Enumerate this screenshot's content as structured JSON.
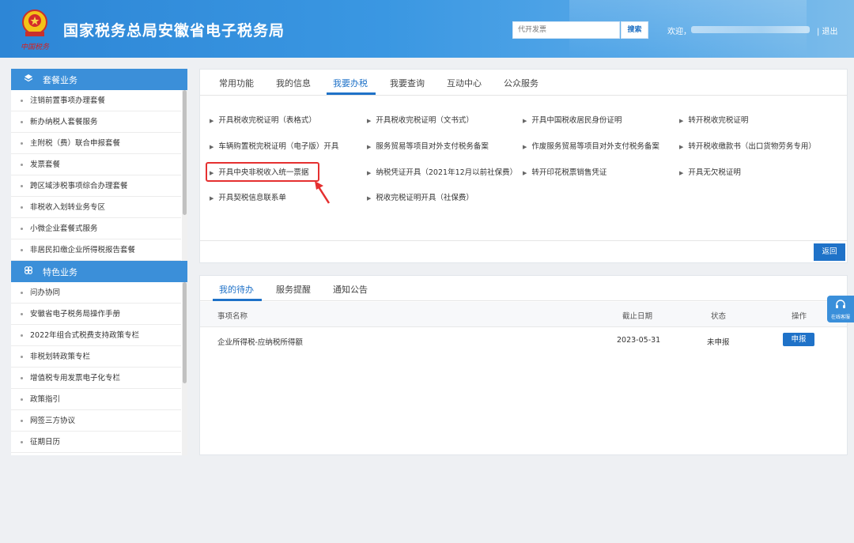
{
  "header": {
    "title": "国家税务总局安徽省电子税务局",
    "emblem_signature": "中国税务",
    "search_placeholder": "代开发票",
    "search_button": "搜索",
    "welcome": "欢迎，",
    "logout": "| 退出",
    "brand_color": "#3a97e2"
  },
  "sidebar": {
    "package_title": "套餐业务",
    "package_items": [
      "注销前置事项办理套餐",
      "新办纳税人套餐服务",
      "主附税（费）联合申报套餐",
      "发票套餐",
      "跨区域涉税事项综合办理套餐",
      "非税收入划转业务专区",
      "小微企业套餐式服务",
      "非居民扣缴企业所得税报告套餐"
    ],
    "feature_title": "特色业务",
    "feature_items": [
      "问办协同",
      "安徽省电子税务局操作手册",
      "2022年组合式税费支持政策专栏",
      "非税划转政策专栏",
      "增值税专用发票电子化专栏",
      "政策指引",
      "网签三方协议",
      "征期日历"
    ]
  },
  "top_tabs": [
    "常用功能",
    "我的信息",
    "我要办税",
    "我要查询",
    "互动中心",
    "公众服务"
  ],
  "services": [
    "开具税收完税证明（表格式）",
    "开具税收完税证明（文书式）",
    "开具中国税收居民身份证明",
    "转开税收完税证明",
    "车辆购置税完税证明（电子版）开具",
    "服务贸易等项目对外支付税务备案",
    "作废服务贸易等项目对外支付税务备案",
    "转开税收缴款书（出口货物劳务专用）",
    "开具中央非税收入统一票据",
    "纳税凭证开具（2021年12月以前社保费）",
    "转开印花税票销售凭证",
    "开具无欠税证明",
    "开具契税信息联系单",
    "税收完税证明开具（社保费）"
  ],
  "back_button": "返回",
  "bottom_tabs": [
    "我的待办",
    "服务提醒",
    "通知公告"
  ],
  "todo_table": {
    "headers": [
      "事项名称",
      "截止日期",
      "状态",
      "操作"
    ],
    "rows": [
      {
        "name": "企业所得税-应纳税所得额",
        "deadline": "2023-05-31",
        "status": "未申报",
        "action": "申报"
      }
    ]
  },
  "float_service": "在线客服"
}
